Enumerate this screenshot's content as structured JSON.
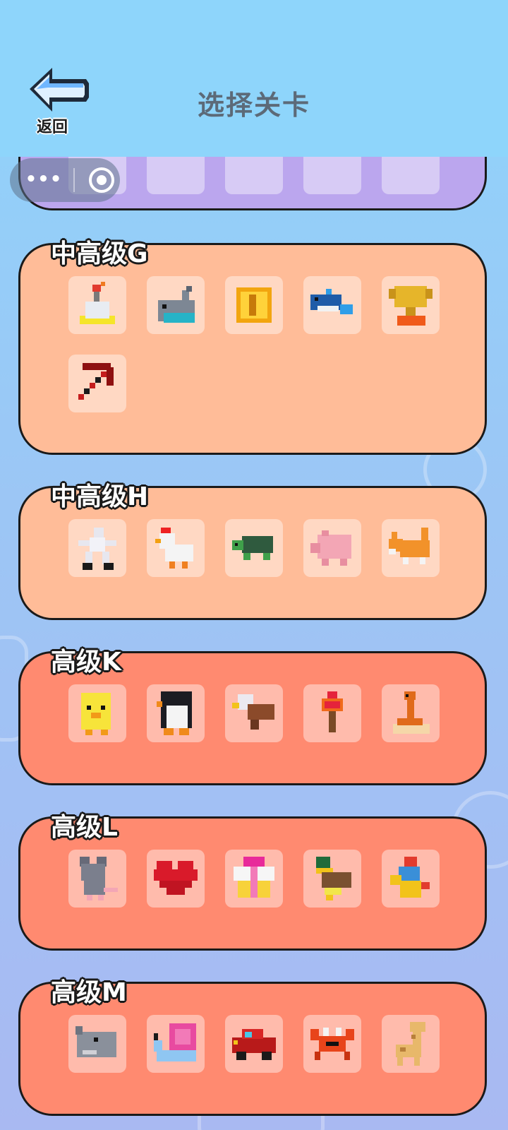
{
  "header": {
    "back_label": "返回",
    "title": "选择关卡"
  },
  "mini_program_capsule": {
    "menu_icon": "more-dots-icon",
    "close_icon": "target-circle-icon"
  },
  "colors": {
    "mid_group_bg": "#ffbc98",
    "advanced_group_bg": "#ff8a70",
    "previous_group_bg": "#bba6ee",
    "header_bg": "#8ed5fb"
  },
  "groups": [
    {
      "label": "中高级G",
      "levels": [
        {
          "icon": "bomb-voxel-icon"
        },
        {
          "icon": "whale-voxel-icon"
        },
        {
          "icon": "gold-coin-voxel-icon"
        },
        {
          "icon": "blue-fish-voxel-icon"
        },
        {
          "icon": "trophy-voxel-icon"
        },
        {
          "icon": "pickaxe-voxel-icon"
        }
      ]
    },
    {
      "label": "中高级H",
      "levels": [
        {
          "icon": "skeleton-voxel-icon"
        },
        {
          "icon": "chicken-voxel-icon"
        },
        {
          "icon": "turtle-voxel-icon"
        },
        {
          "icon": "pig-voxel-icon"
        },
        {
          "icon": "fox-voxel-icon"
        }
      ]
    },
    {
      "label": "高级K",
      "levels": [
        {
          "icon": "chick-voxel-icon"
        },
        {
          "icon": "penguin-voxel-icon"
        },
        {
          "icon": "eagle-voxel-icon"
        },
        {
          "icon": "torch-voxel-icon"
        },
        {
          "icon": "snake-voxel-icon"
        }
      ]
    },
    {
      "label": "高级L",
      "levels": [
        {
          "icon": "mouse-voxel-icon"
        },
        {
          "icon": "heart-voxel-icon"
        },
        {
          "icon": "gift-box-voxel-icon"
        },
        {
          "icon": "duck-voxel-icon"
        },
        {
          "icon": "robot-voxel-icon"
        }
      ]
    },
    {
      "label": "高级M",
      "levels": [
        {
          "icon": "rhino-voxel-icon"
        },
        {
          "icon": "snail-voxel-icon"
        },
        {
          "icon": "car-voxel-icon"
        },
        {
          "icon": "crab-voxel-icon"
        },
        {
          "icon": "giraffe-voxel-icon"
        }
      ]
    }
  ]
}
